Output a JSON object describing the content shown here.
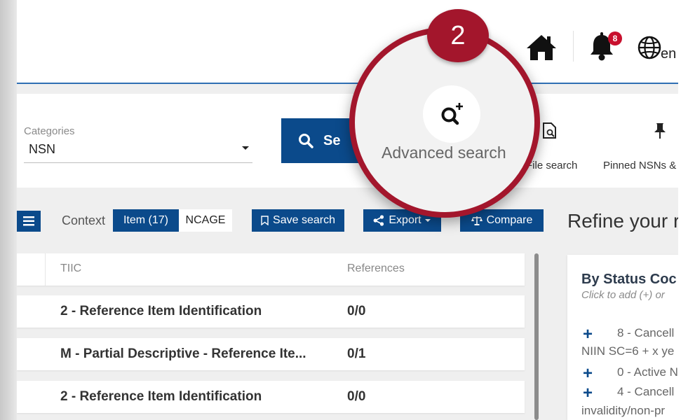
{
  "header": {
    "notification_count": "8",
    "language": "en"
  },
  "search": {
    "category_label": "Categories",
    "category_value": "NSN",
    "search_button": "Se",
    "advanced_search": "Advanced search",
    "file_search": "File search",
    "pinned": "Pinned NSNs &",
    "step_number": "2"
  },
  "toolbar": {
    "context_label": "Context",
    "tab_item": "Item (17)",
    "tab_ncage": "NCAGE",
    "save_search": "Save search",
    "export": "Export",
    "compare": "Compare"
  },
  "table": {
    "columns": [
      "TIIC",
      "References"
    ],
    "rows": [
      {
        "tiic": "2 - Reference Item Identification",
        "refs": "0/0"
      },
      {
        "tiic": "M - Partial Descriptive - Reference Ite...",
        "refs": "0/1"
      },
      {
        "tiic": "2 - Reference Item Identification",
        "refs": "0/0"
      }
    ]
  },
  "refine": {
    "title": "Refine your r",
    "card_title": "By Status Coc",
    "hint": "Click to add (+) or",
    "entries": [
      {
        "text": "8 - Cancell",
        "sub": "NIIN SC=6 + x ye"
      },
      {
        "text": "0 - Active N",
        "sub": ""
      },
      {
        "text": "4 - Cancell",
        "sub": "invalidity/non-pr"
      }
    ]
  },
  "colors": {
    "primary": "#0b4a8b",
    "accent_red": "#a3162c",
    "header_rule": "#2f6fb3"
  }
}
